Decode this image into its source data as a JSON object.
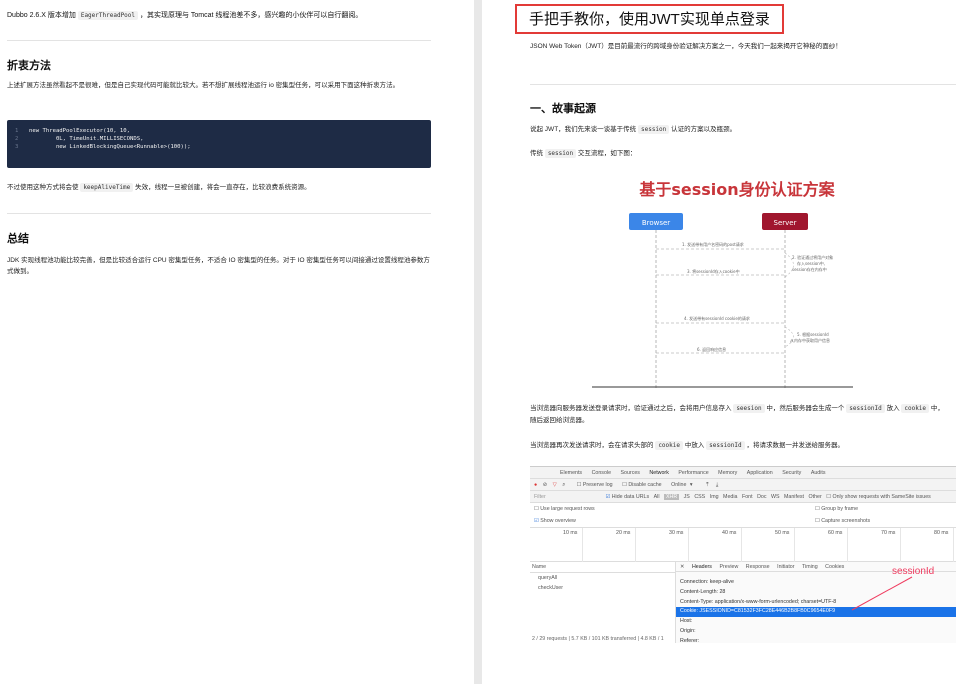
{
  "left": {
    "intro_prefix": "Dubbo 2.6.X 版本增加",
    "intro_code": "EagerThreadPool",
    "intro_suffix": "，其实现原理与 Tomcat 线程池差不多，感兴趣的小伙伴可以自行翻阅。",
    "section1_title": "折衷方法",
    "section1_para": "上述扩展方法虽然看起不是很难，但是自己实现代码可能就比较大。若不想扩展线程池运行 io 密集型任务，可以采用下面这种折衷方法。",
    "code_lines": [
      {
        "n": "1",
        "t": "new ThreadPoolExecutor(10, 10,"
      },
      {
        "n": "2",
        "t": "        0L, TimeUnit.MILLISECONDS,"
      },
      {
        "n": "3",
        "t": "        new LinkedBlockingQueue<Runnable>(100));"
      }
    ],
    "after_code_prefix": "不过使用这种方式将会使",
    "after_code_code": "keepAliveTime",
    "after_code_suffix": "失效，线程一旦被创建，将会一直存在，比较浪费系统资源。",
    "section2_title": "总结",
    "section2_para": "JDK 实现线程池功能比较完善，但是比较适合运行 CPU 密集型任务，不适合 IO 密集型的任务。对于 IO 密集型任务可以间接通过设置线程池参数方式做到。"
  },
  "right": {
    "title": "手把手教你，使用JWT实现单点登录",
    "intro": "JSON Web Token（JWT）是目前最流行的跨域身份验证解决方案之一，今天我们一起来揭开它神秘的面纱！",
    "section_title": "一、故事起源",
    "p1_prefix": "说起 JWT，我们先来谈一谈基于传统",
    "p1_code": "session",
    "p1_suffix": "认证的方案以及瓶颈。",
    "p2_prefix": "传统",
    "p2_code": "session",
    "p2_suffix": "交互流程，如下图：",
    "diagram": {
      "title": "基于session身份认证方案",
      "browser": "Browser",
      "server": "Server",
      "steps": [
        "1. 发送带有用户名密码的post请求",
        "2. 验证通过将用户对象存入session中，session存在内存中",
        "3. 将sessionId存入cookie中",
        "4. 发送带有sessionId cookie的请求",
        "5. 根据sessionId从内存中获取用户信息",
        "6. 返回响应信息"
      ],
      "colors": {
        "title": "#c8353a",
        "browser": "#3b86e8",
        "server": "#a0162e"
      }
    },
    "p3_a": "当浏览器向服务器发送登录请求时，验证通过之后，会将用户信息存入",
    "p3_code1": "seesion",
    "p3_b": "中，然后服务器会生成一个",
    "p3_code2": "sessionId",
    "p3_c": "放入",
    "p3_code3": "cookie",
    "p3_d": "中，随后返回给浏览器。",
    "p4_a": "当浏览器再次发送请求时，会在请求头部的",
    "p4_code1": "cookie",
    "p4_b": "中放入",
    "p4_code2": "sessionId",
    "p4_c": "，将请求数据一并发送给服务器。",
    "devtools": {
      "tabs": [
        "Elements",
        "Console",
        "Sources",
        "Network",
        "Performance",
        "Memory",
        "Application",
        "Security",
        "Audits"
      ],
      "toolbar": [
        "Preserve log",
        "Disable cache",
        "Online"
      ],
      "filter_placeholder": "Filter",
      "filter_types": [
        "Hide data URLs",
        "All",
        "XHR",
        "JS",
        "CSS",
        "Img",
        "Media",
        "Font",
        "Doc",
        "WS",
        "Manifest",
        "Other",
        "Only show requests with SameSite issues"
      ],
      "opt1": "Use large request rows",
      "opt2": "Group by frame",
      "opt3": "Show overview",
      "opt4": "Capture screenshots",
      "ticks": [
        "10 ms",
        "20 ms",
        "30 ms",
        "40 ms",
        "50 ms",
        "60 ms",
        "70 ms",
        "80 ms"
      ],
      "name_header": "Name",
      "requests": [
        "queryAll",
        "checkUser"
      ],
      "detail_tabs": [
        "Headers",
        "Preview",
        "Response",
        "Initiator",
        "Timing",
        "Cookies"
      ],
      "headers": [
        "Connection: keep-alive",
        "Content-Length: 28",
        "Content-Type: application/x-www-form-urlencoded; charset=UTF-8",
        "Cookie: JSESSIONID=C81532F3FC28E446B2B8FB0C9654E0F9",
        "Host:",
        "Origin:",
        "Referer:"
      ],
      "status": "2 / 29 requests  |  5.7 KB / 101 KB transferred  |  4.8 KB / 1",
      "annotation": "sessionId"
    }
  }
}
